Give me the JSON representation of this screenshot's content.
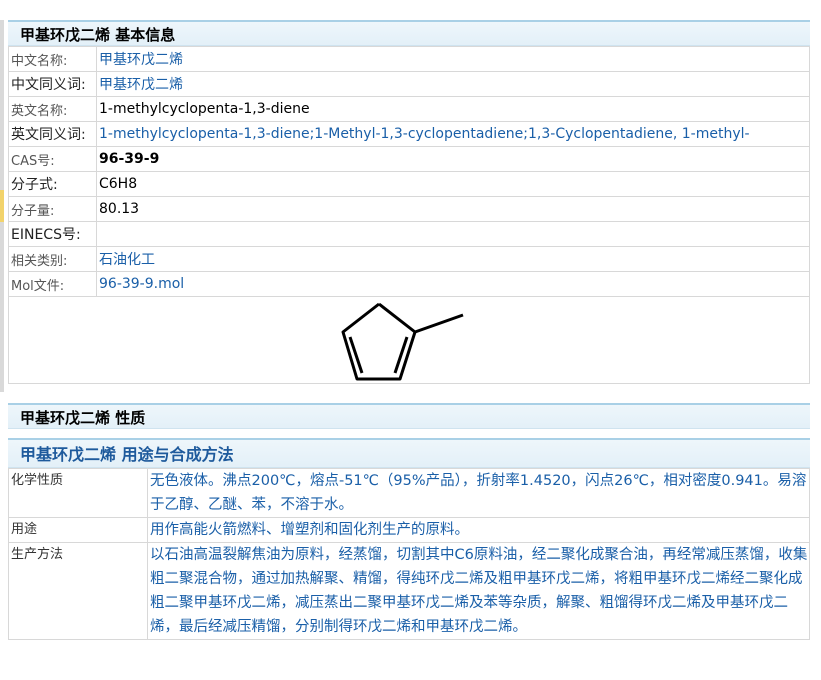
{
  "basic": {
    "title": "甲基环戊二烯 基本信息",
    "rows": [
      {
        "label": "中文名称:",
        "value": "甲基环戊二烯"
      },
      {
        "label": "中文同义词:",
        "value": "甲基环戊二烯"
      },
      {
        "label": "英文名称:",
        "value": "1-methylcyclopenta-1,3-diene"
      },
      {
        "label": "英文同义词:",
        "value": "1-methylcyclopenta-1,3-diene;1-Methyl-1,3-cyclopentadiene;1,3-Cyclopentadiene, 1-methyl-"
      },
      {
        "label": "CAS号:",
        "value": "96-39-9"
      },
      {
        "label": "分子式:",
        "value": "C6H8"
      },
      {
        "label": "分子量:",
        "value": "80.13"
      },
      {
        "label": "EINECS号:",
        "value": ""
      },
      {
        "label": "相关类别:",
        "value": "石油化工"
      },
      {
        "label": "Mol文件:",
        "value": "96-39-9.mol"
      }
    ]
  },
  "properties": {
    "title": "甲基环戊二烯 性质"
  },
  "usage": {
    "title": "甲基环戊二烯 用途与合成方法",
    "rows": [
      {
        "label": "化学性质",
        "value": "无色液体。沸点200℃，熔点-51℃（95%产品），折射率1.4520，闪点26℃，相对密度0.941。易溶于乙醇、乙醚、苯，不溶于水。"
      },
      {
        "label": "用途",
        "value": "用作高能火箭燃料、增塑剂和固化剂生产的原料。"
      },
      {
        "label": "生产方法",
        "value": "以石油高温裂解焦油为原料，经蒸馏，切割其中C6原料油，经二聚化成聚合油，再经常减压蒸馏，收集粗二聚混合物，通过加热解聚、精馏，得纯环戊二烯及粗甲基环戊二烯，将粗甲基环戊二烯经二聚化成粗二聚甲基环戊二烯，减压蒸出二聚甲基环戊二烯及苯等杂质，解聚、粗馏得环戊二烯及甲基环戊二烯，最后经减压精馏，分别制得环戊二烯和甲基环戊二烯。"
      }
    ]
  }
}
